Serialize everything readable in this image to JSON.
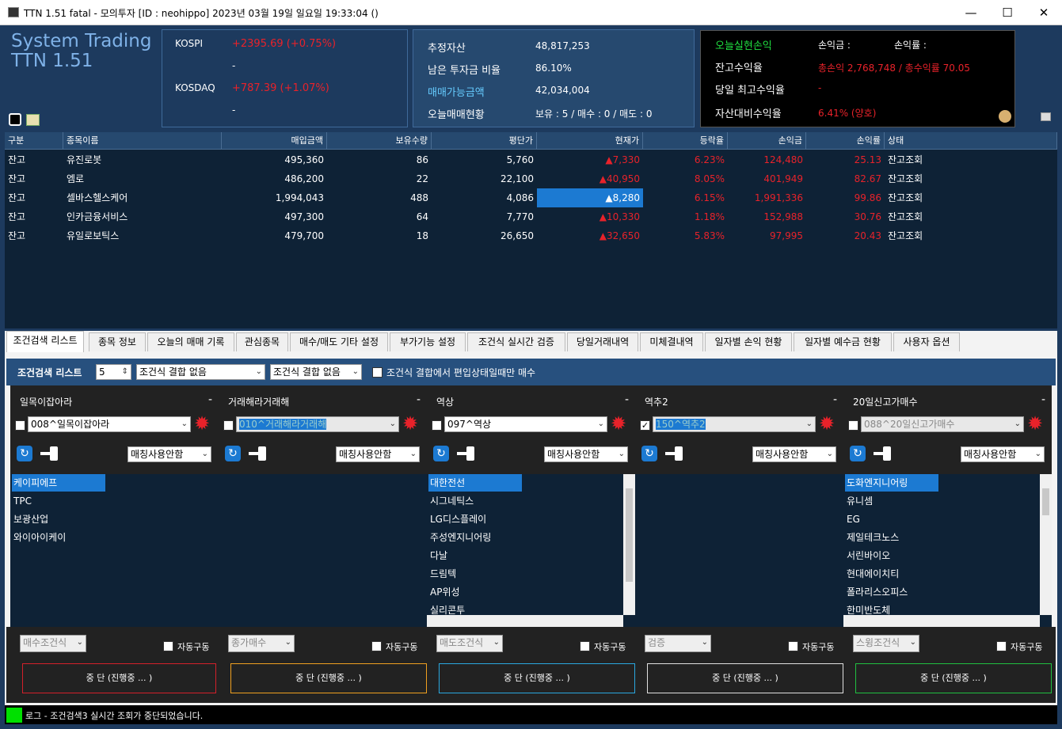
{
  "window": {
    "title": "TTN 1.51 fatal - 모의투자 [ID : neohippo] 2023년 03월 19일 일요일 19:33:04 ()",
    "minimize": "—",
    "maximize": "☐",
    "close": "✕"
  },
  "brand": {
    "line1": "System Trading",
    "line2": "TTN 1.51"
  },
  "market": {
    "kospi_label": "KOSPI",
    "kospi_value": "+2395.69 (+0.75%)",
    "kospi_sub": "-",
    "kosdaq_label": "KOSDAQ",
    "kosdaq_value": "+787.39 (+1.07%)",
    "kosdaq_sub": "-"
  },
  "assets": {
    "est_label": "추정자산",
    "est_value": "48,817,253",
    "ratio_label": "남은 투자금 비율",
    "ratio_value": "86.10%",
    "avail_label": "매매가능금액",
    "avail_value": "42,034,004",
    "today_label": "오늘매매현황",
    "today_value": "보유 : 5 / 매수 : 0 / 매도 : 0"
  },
  "pnl": {
    "realized_label": "오늘실현손익",
    "loss_label": "손익금 :",
    "profit_label": "손익률 :",
    "balance_label": "잔고수익율",
    "balance_value": "총손익 2,768,748 / 총수익률 70.05",
    "maxday_label": "당일 최고수익율",
    "maxday_value": "-",
    "asset_ratio_label": "자산대비수익율",
    "asset_ratio_value": "6.41% (양호)"
  },
  "grid": {
    "headers": [
      "구분",
      "종목이름",
      "매입금액",
      "보유수량",
      "평단가",
      "현재가",
      "등락율",
      "손익금",
      "손익률",
      "상태"
    ],
    "rows": [
      [
        "잔고",
        "유진로봇",
        "495,360",
        "86",
        "5,760",
        "▲7,330",
        "6.23%",
        "124,480",
        "25.13",
        "잔고조회"
      ],
      [
        "잔고",
        "엠로",
        "486,200",
        "22",
        "22,100",
        "▲40,950",
        "8.05%",
        "401,949",
        "82.67",
        "잔고조회"
      ],
      [
        "잔고",
        "셀바스헬스케어",
        "1,994,043",
        "488",
        "4,086",
        "▲8,280",
        "6.15%",
        "1,991,336",
        "99.86",
        "잔고조회"
      ],
      [
        "잔고",
        "인카금융서비스",
        "497,300",
        "64",
        "7,770",
        "▲10,330",
        "1.18%",
        "152,988",
        "30.76",
        "잔고조회"
      ],
      [
        "잔고",
        "유일로보틱스",
        "479,700",
        "18",
        "26,650",
        "▲32,650",
        "5.83%",
        "97,995",
        "20.43",
        "잔고조회"
      ]
    ]
  },
  "tabs": [
    "조건검색 리스트",
    "종목 정보",
    "오늘의 매매 기록",
    "관심종목",
    "매수/매도 기타 설정",
    "부가기능 설정",
    "조건식 실시간 검증",
    "당일거래내역",
    "미체결내역",
    "일자별 손익 현황",
    "일자별 예수금 현황",
    "사용자 옵션"
  ],
  "condbar": {
    "label": "조건검색 리스트",
    "count": "5",
    "combo1": "조건식 결합 없음",
    "combo2": "조건식 결합 없음",
    "only_label": "조건식 결합에서 편입상태일때만 매수"
  },
  "columns": [
    {
      "title": "일목이잡아라",
      "cond": "008^일목이잡아라",
      "match": "매칭사용안함",
      "items": [
        "케이피에프",
        "TPC",
        "보광산업",
        "와이아이케이"
      ],
      "order": "매수조건식",
      "auto": "자동구동",
      "stop": "중 단 (진행중 ... )",
      "color": "#d4202a"
    },
    {
      "title": "거래해라거래해",
      "cond": "010^거래해라거래해",
      "match": "매칭사용안함",
      "items": [],
      "order": "종가매수",
      "auto": "자동구동",
      "stop": "중 단 (진행중 ... )",
      "color": "#f0a020"
    },
    {
      "title": "역상",
      "cond": "097^역상",
      "match": "매칭사용안함",
      "items": [
        "대한전선",
        "시그네틱스",
        "LG디스플레이",
        "주성엔지니어링",
        "다날",
        "드림텍",
        "AP위성",
        "실리콘투"
      ],
      "order": "매도조건식",
      "auto": "자동구동",
      "stop": "중 단 (진행중 ... )",
      "color": "#2aa8e0"
    },
    {
      "title": "역추2",
      "cond": "150^역추2",
      "match": "매칭사용안함",
      "items": [],
      "order": "검증",
      "auto": "자동구동",
      "stop": "중 단 (진행중 ... )",
      "color": "#e0e0e0"
    },
    {
      "title": "20일신고가매수",
      "cond": "088^20일신고가매수",
      "match": "매칭사용안함",
      "items": [
        "도화엔지니어링",
        "유니셈",
        "EG",
        "제일테크노스",
        "서린바이오",
        "현대에이치티",
        "폴라리스오피스",
        "한미반도체"
      ],
      "order": "스윙조건식",
      "auto": "자동구동",
      "stop": "중 단 (진행중 ... )",
      "color": "#20c040"
    }
  ],
  "log": {
    "text": "로그 - 조건검색3 실시간 조회가 중단되었습니다."
  },
  "colors": {
    "accent": "#1c7ad2",
    "up": "#e8222a",
    "panel": "#1d3a5e"
  }
}
